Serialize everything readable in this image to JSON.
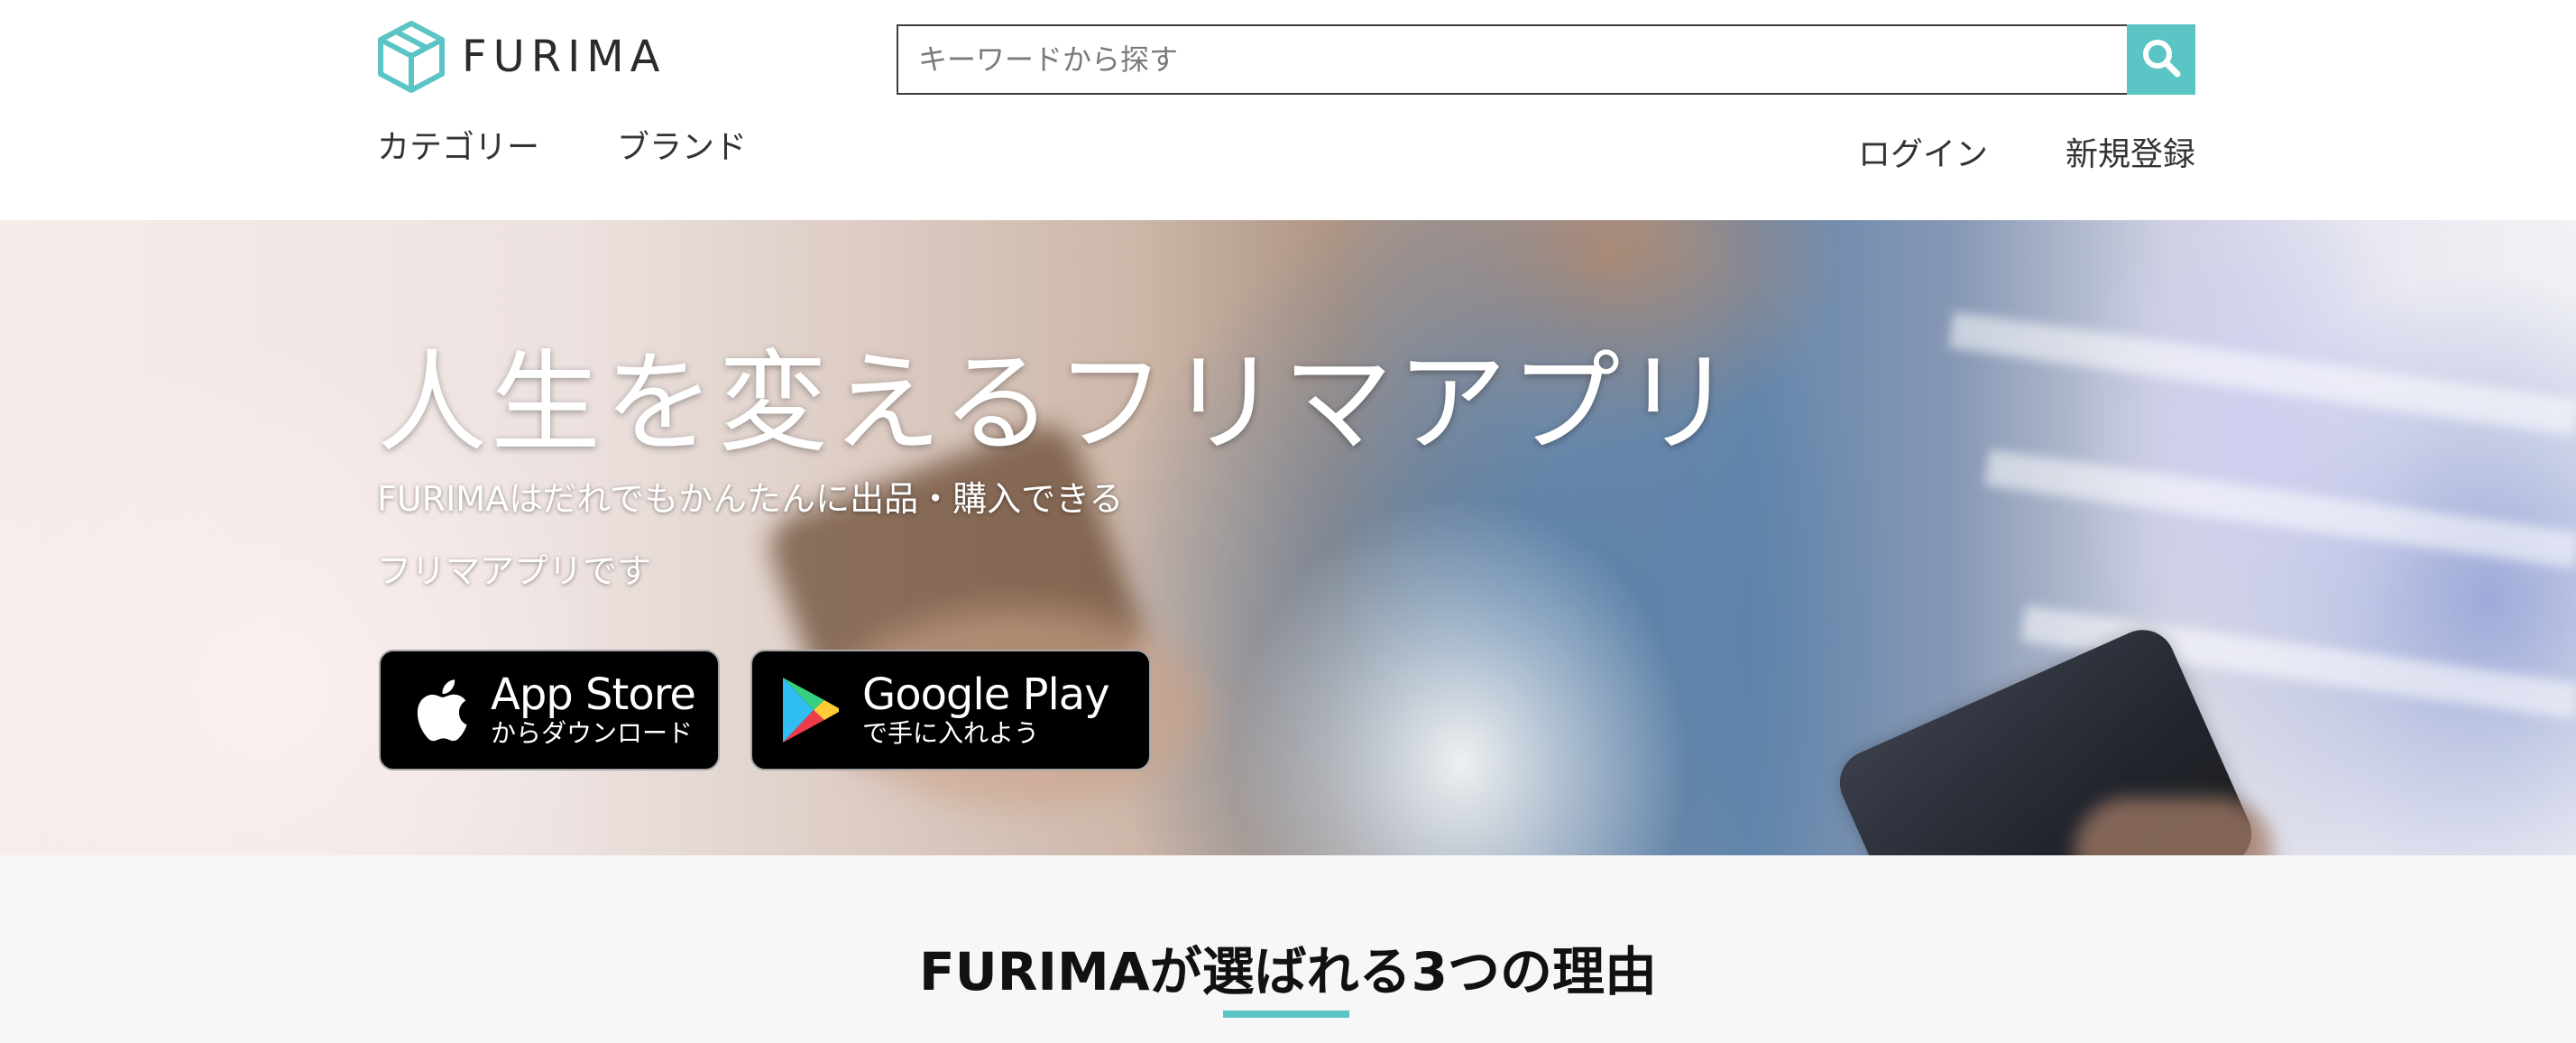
{
  "brand": {
    "name": "FURIMA",
    "accent_color": "#5bc4c4",
    "logo_icon": "box-icon"
  },
  "search": {
    "placeholder": "キーワードから探す",
    "value": "",
    "button_icon": "search-icon"
  },
  "nav": {
    "left": [
      {
        "label": "カテゴリー"
      },
      {
        "label": "ブランド"
      }
    ],
    "right": [
      {
        "label": "ログイン"
      },
      {
        "label": "新規登録"
      }
    ]
  },
  "hero": {
    "title": "人生を変えるフリマアプリ",
    "subtitle_line1": "FURIMAはだれでもかんたんに出品・購入できる",
    "subtitle_line2": "フリマアプリです",
    "app_store": {
      "icon": "apple-icon",
      "title": "App Store",
      "subtitle": "からダウンロード"
    },
    "google_play": {
      "icon": "google-play-icon",
      "title": "Google Play",
      "subtitle": "で手に入れよう"
    }
  },
  "reasons": {
    "heading": "FURIMAが選ばれる3つの理由"
  }
}
